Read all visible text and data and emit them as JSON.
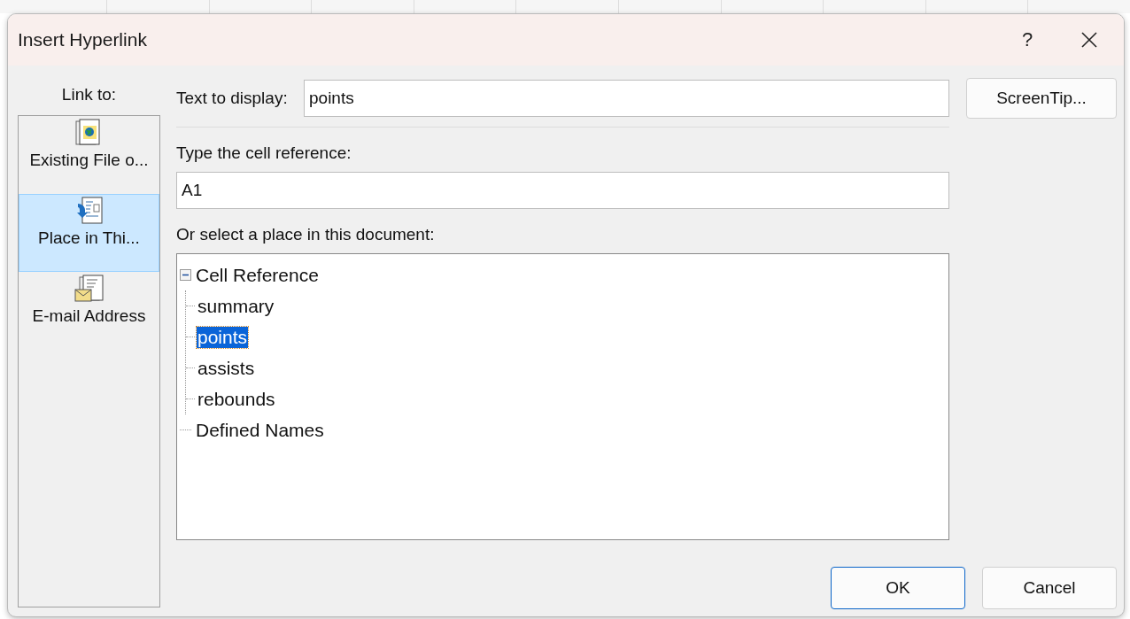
{
  "window": {
    "title": "Insert Hyperlink",
    "help": "?"
  },
  "link_to": {
    "label": "Link to:",
    "items": [
      {
        "label": "Existing File o...",
        "kind": "file",
        "selected": false
      },
      {
        "label": "Place in Thi...",
        "kind": "place",
        "selected": true
      },
      {
        "label": "E-mail Address",
        "kind": "email",
        "selected": false
      }
    ]
  },
  "text_to_display": {
    "label": "Text to display:",
    "value": "points"
  },
  "screentip_button": "ScreenTip...",
  "cell_reference": {
    "label": "Type the cell reference:",
    "value": "A1"
  },
  "place_list": {
    "label": "Or select a place in this document:",
    "tree": [
      {
        "label": "Cell Reference",
        "expanded": true,
        "selected": false,
        "children": [
          {
            "label": "summary",
            "selected": false
          },
          {
            "label": "points",
            "selected": true
          },
          {
            "label": "assists",
            "selected": false
          },
          {
            "label": "rebounds",
            "selected": false
          }
        ]
      },
      {
        "label": "Defined Names",
        "selected": false
      }
    ]
  },
  "buttons": [
    {
      "label": "OK",
      "default": true
    },
    {
      "label": "Cancel",
      "default": false
    }
  ]
}
